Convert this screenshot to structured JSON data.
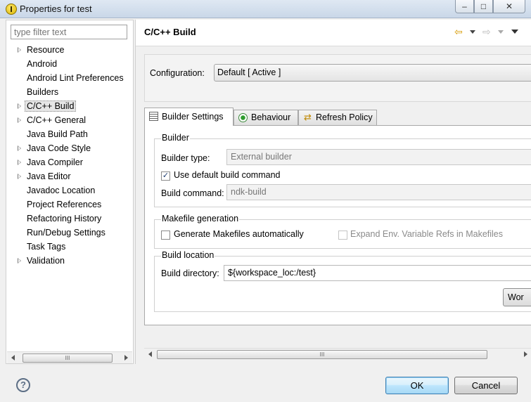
{
  "window": {
    "title": "Properties for test",
    "controls": {
      "minimize": "–",
      "maximize": "□",
      "close": "✕"
    }
  },
  "filter": {
    "placeholder": "type filter text"
  },
  "tree": [
    {
      "label": "Resource",
      "expandable": true
    },
    {
      "label": "Android",
      "expandable": false
    },
    {
      "label": "Android Lint Preferences",
      "expandable": false
    },
    {
      "label": "Builders",
      "expandable": false
    },
    {
      "label": "C/C++ Build",
      "expandable": true,
      "selected": true
    },
    {
      "label": "C/C++ General",
      "expandable": true
    },
    {
      "label": "Java Build Path",
      "expandable": false
    },
    {
      "label": "Java Code Style",
      "expandable": true
    },
    {
      "label": "Java Compiler",
      "expandable": true
    },
    {
      "label": "Java Editor",
      "expandable": true
    },
    {
      "label": "Javadoc Location",
      "expandable": false
    },
    {
      "label": "Project References",
      "expandable": false
    },
    {
      "label": "Refactoring History",
      "expandable": false
    },
    {
      "label": "Run/Debug Settings",
      "expandable": false
    },
    {
      "label": "Task Tags",
      "expandable": false
    },
    {
      "label": "Validation",
      "expandable": true
    }
  ],
  "page": {
    "title": "C/C++ Build",
    "configuration": {
      "label": "Configuration:",
      "value": "Default  [ Active ]"
    },
    "tabs": [
      {
        "label": "Builder Settings",
        "icon": "list-icon",
        "active": true
      },
      {
        "label": "Behaviour",
        "icon": "radio-icon",
        "active": false
      },
      {
        "label": "Refresh Policy",
        "icon": "refresh-icon",
        "active": false
      }
    ],
    "builder": {
      "group_title": "Builder",
      "type_label": "Builder type:",
      "type_value": "External builder",
      "use_default_label": "Use default build command",
      "use_default_checked": true,
      "command_label": "Build command:",
      "command_value": "ndk-build"
    },
    "makefile": {
      "group_title": "Makefile generation",
      "generate_label": "Generate Makefiles automatically",
      "generate_checked": false,
      "expand_label": "Expand Env. Variable Refs in Makefiles",
      "expand_checked": false
    },
    "location": {
      "group_title": "Build location",
      "dir_label": "Build directory:",
      "dir_value": "${workspace_loc:/test}",
      "workspace_button": "Wor"
    }
  },
  "scroll_thumb": "III",
  "buttons": {
    "help": "?",
    "ok": "OK",
    "cancel": "Cancel"
  }
}
